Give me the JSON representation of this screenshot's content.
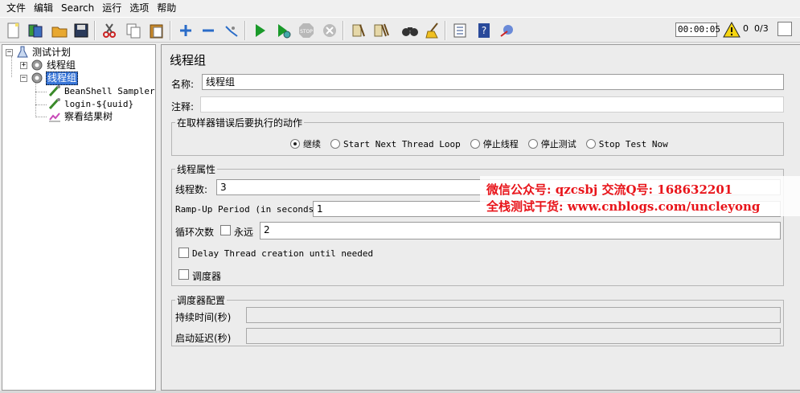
{
  "menu": [
    "文件",
    "编辑",
    "Search",
    "运行",
    "选项",
    "帮助"
  ],
  "toolbar": {
    "icons": [
      "new-icon",
      "templates-icon",
      "open-icon",
      "save-icon",
      "cut-icon",
      "copy-icon",
      "paste-icon",
      "expand-icon",
      "collapse-icon",
      "toggle-icon",
      "start-icon",
      "start-no-pause-icon",
      "stop-icon",
      "shutdown-icon",
      "clear-icon",
      "clear-all-icon",
      "search-icon",
      "reset-search-icon",
      "function-helper-icon",
      "help-icon",
      "remote-icon"
    ],
    "timer": "00:00:05",
    "error_count": "0",
    "thread_count": "0/3"
  },
  "tree": {
    "items": [
      {
        "label": "测试计划",
        "icon": "test-plan-icon",
        "toggle": "−"
      },
      {
        "label": "线程组",
        "icon": "gear-icon",
        "toggle": "+"
      },
      {
        "label": "线程组",
        "icon": "gear-icon",
        "toggle": "−",
        "selected": true
      },
      {
        "label": "BeanShell Sampler",
        "icon": "sampler-icon"
      },
      {
        "label": "login-${uuid}",
        "icon": "sampler-icon"
      },
      {
        "label": "察看结果树",
        "icon": "listener-icon"
      }
    ]
  },
  "main": {
    "title": "线程组",
    "name_label": "名称:",
    "name_value": "线程组",
    "comment_label": "注释:",
    "comment_value": "",
    "error_action": {
      "legend": "在取样器错误后要执行的动作",
      "options": [
        "继续",
        "Start Next Thread Loop",
        "停止线程",
        "停止测试",
        "Stop Test Now"
      ],
      "selected": 0
    },
    "thread_props": {
      "legend": "线程属性",
      "threads_label": "线程数:",
      "threads_value": "3",
      "rampup_label": "Ramp-Up Period (in seconds):",
      "rampup_value": "1",
      "loop_label": "循环次数",
      "forever_label": "永远",
      "loop_value": "2",
      "delay_label": "Delay Thread creation until needed",
      "scheduler_label": "调度器"
    },
    "scheduler_config": {
      "legend": "调度器配置",
      "duration_label": "持续时间(秒)",
      "delay_label": "启动延迟(秒)"
    }
  },
  "watermark": {
    "line1": "微信公众号: qzcsbj   交流Q号: 168632201",
    "line2": "全栈测试干货: www.cnblogs.com/uncleyong"
  },
  "colors": {
    "selection": "#3875d7",
    "watermark": "#e8141a"
  }
}
